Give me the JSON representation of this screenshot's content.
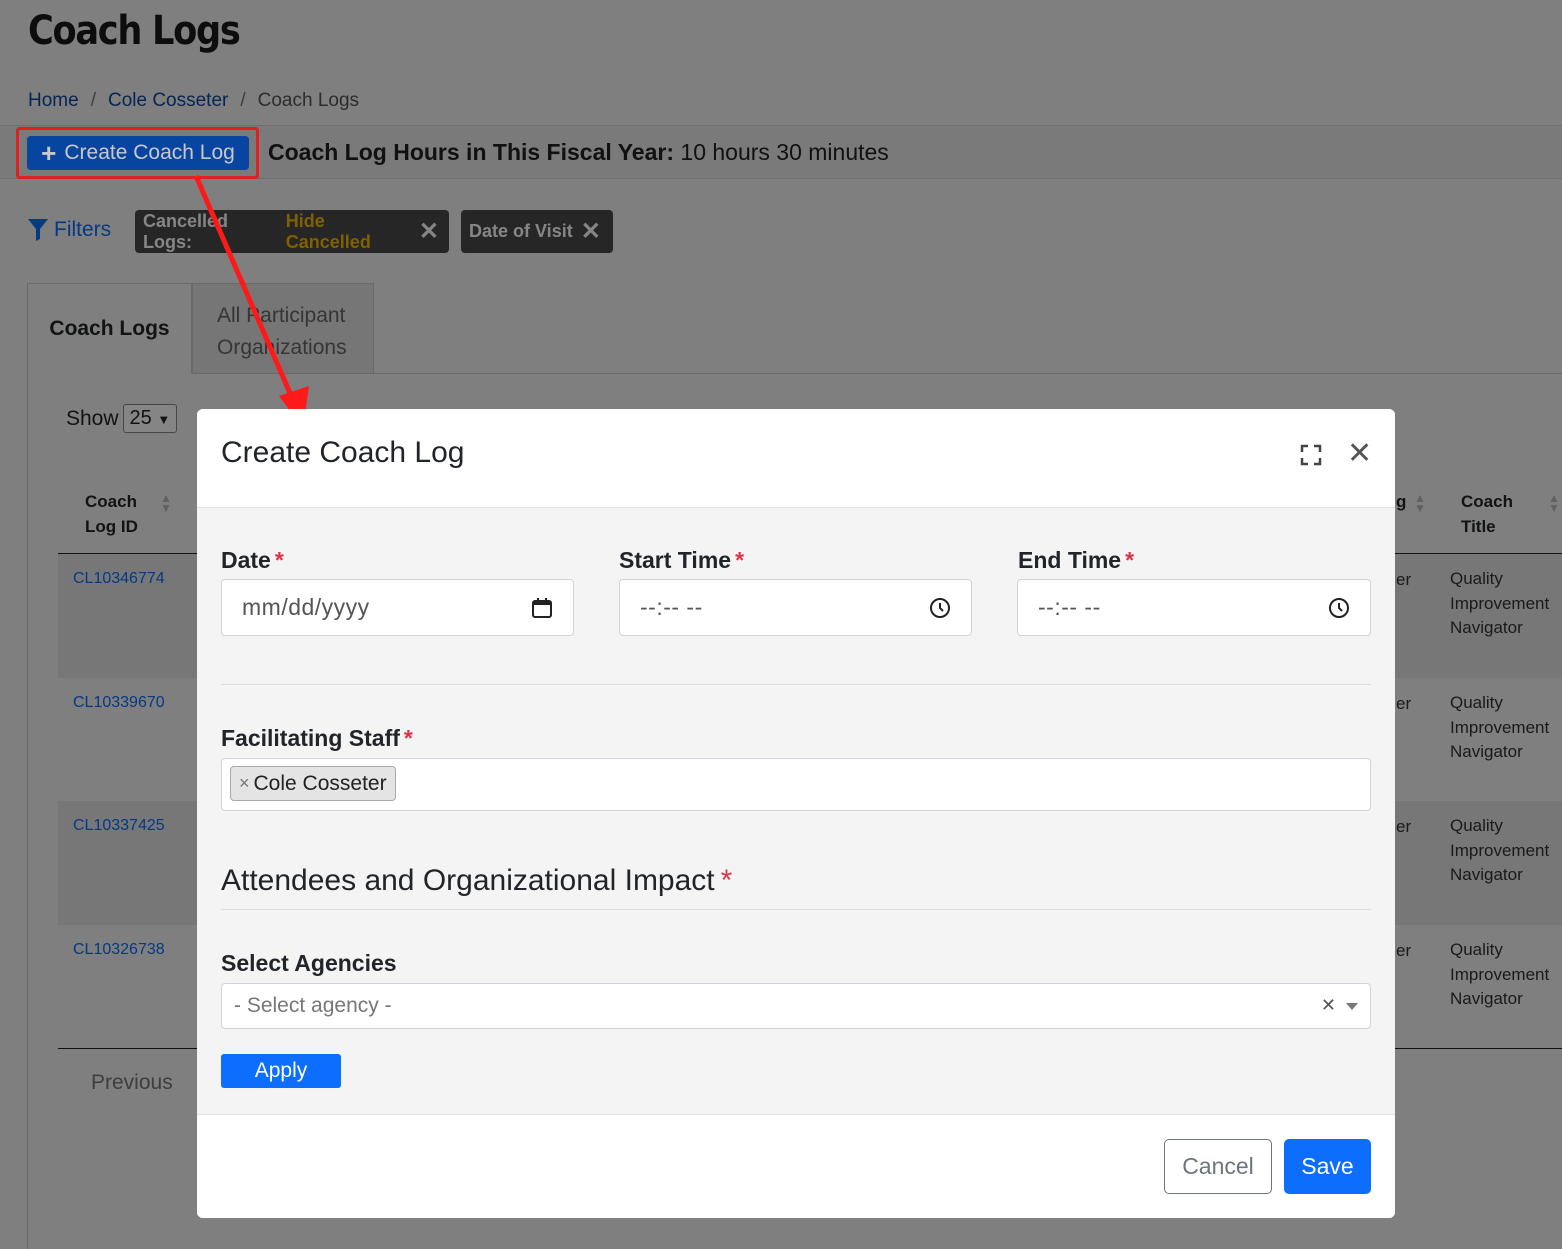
{
  "page": {
    "title": "Coach Logs",
    "breadcrumb": [
      "Home",
      "Cole Cosseter",
      "Coach Logs"
    ],
    "create_button": "Create Coach Log",
    "hours_label": "Coach Log Hours in This Fiscal Year:",
    "hours_value": "10 hours 30 minutes",
    "filters_label": "Filters",
    "chips": [
      {
        "label": "Cancelled Logs:",
        "value": "Hide Cancelled"
      },
      {
        "label": "Date of Visit",
        "value": ""
      }
    ],
    "tabs": [
      "Coach Logs",
      "All Participant Organizations"
    ],
    "show_label": "Show",
    "show_value": "25",
    "columns": {
      "id": "Coach Log ID",
      "title": "Coach Title",
      "partial": "g"
    },
    "rows": [
      {
        "id": "CL10346774",
        "partial": "er",
        "title": "Quality Improvement Navigator"
      },
      {
        "id": "CL10339670",
        "partial": "er",
        "title": "Quality Improvement Navigator"
      },
      {
        "id": "CL10337425",
        "partial": "er",
        "title": "Quality Improvement Navigator"
      },
      {
        "id": "CL10326738",
        "partial": "er",
        "title": "Quality Improvement Navigator"
      }
    ],
    "previous_label": "Previous"
  },
  "modal": {
    "title": "Create Coach Log",
    "date_label": "Date",
    "date_placeholder": "mm/dd/yyyy",
    "start_label": "Start Time",
    "start_placeholder": "--:-- --",
    "end_label": "End Time",
    "end_placeholder": "--:-- --",
    "required_mark": "*",
    "staff_label": "Facilitating Staff",
    "staff_tag": "Cole Cosseter",
    "section_title": "Attendees and Organizational Impact",
    "agencies_label": "Select Agencies",
    "agency_placeholder": "- Select agency -",
    "apply_label": "Apply",
    "cancel_label": "Cancel",
    "save_label": "Save"
  },
  "colors": {
    "primary": "#0d6efd",
    "required": "#dc3545",
    "highlight": "#e02020",
    "chip_value": "#f5b800"
  },
  "icons": [
    "plus-icon",
    "filter-icon",
    "close-x-icon",
    "calendar-icon",
    "clock-icon",
    "expand-icon",
    "close-icon",
    "chevron-down-icon"
  ]
}
